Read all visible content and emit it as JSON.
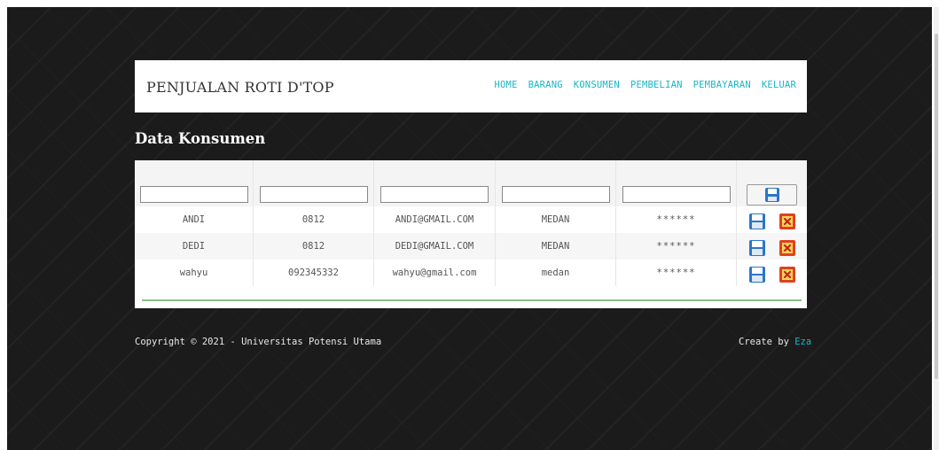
{
  "brand": "PENJUALAN ROTI D'TOP",
  "nav": [
    "HOME",
    "BARANG",
    "KONSUMEN",
    "PEMBELIAN",
    "PEMBAYARAN",
    "KELUAR"
  ],
  "page_title": "Data Konsumen",
  "inputs": {
    "nama": "",
    "telepon": "",
    "email": "",
    "alamat": "",
    "password": ""
  },
  "rows": [
    {
      "nama": "ANDI",
      "telepon": "0812",
      "email": "ANDI@GMAIL.COM",
      "alamat": "MEDAN",
      "password": "******"
    },
    {
      "nama": "DEDI",
      "telepon": "0812",
      "email": "DEDI@GMAIL.COM",
      "alamat": "MEDAN",
      "password": "******"
    },
    {
      "nama": "wahyu",
      "telepon": "092345332",
      "email": "wahyu@gmail.com",
      "alamat": "medan",
      "password": "******"
    }
  ],
  "icons": {
    "save": "floppy-disk-icon",
    "delete": "delete-icon"
  },
  "footer": {
    "copyright": "Copyright © 2021 - Universitas Potensi Utama",
    "create_by_prefix": "Create by ",
    "create_by_name": "Eza"
  },
  "colors": {
    "background": "#1b1b1b",
    "accent": "#19b6c9",
    "divider": "#8fbf8a",
    "delete_red": "#e0401e",
    "save_blue": "#2b76c8"
  }
}
